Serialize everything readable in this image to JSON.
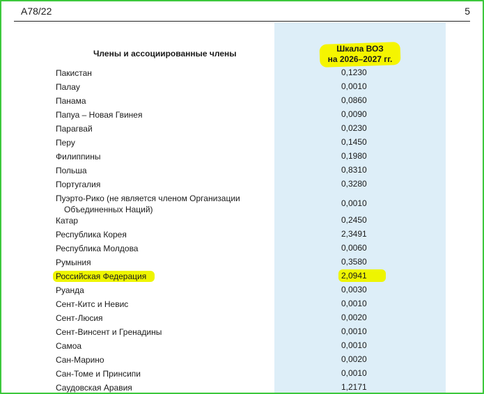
{
  "header": {
    "doc_code": "A78/22",
    "page_number": "5"
  },
  "table": {
    "col_members": "Члены и ассоциированные члены",
    "col_scale_line1": "Шкала ВОЗ",
    "col_scale_line2": "на 2026–2027 гг.",
    "rows": [
      {
        "name": "Пакистан",
        "value": "0,1230"
      },
      {
        "name": "Палау",
        "value": "0,0010"
      },
      {
        "name": "Панама",
        "value": "0,0860"
      },
      {
        "name": "Папуа – Новая Гвинея",
        "value": "0,0090"
      },
      {
        "name": "Парагвай",
        "value": "0,0230"
      },
      {
        "name": "Перу",
        "value": "0,1450"
      },
      {
        "name": "Филиппины",
        "value": "0,1980"
      },
      {
        "name": "Польша",
        "value": "0,8310"
      },
      {
        "name": "Португалия",
        "value": "0,3280"
      },
      {
        "name": "Пуэрто-Рико (не является членом Организации",
        "name_line2": "Объединенных Наций)",
        "value": "0,0010"
      },
      {
        "name": "Катар",
        "value": "0,2450"
      },
      {
        "name": "Республика Корея",
        "value": "2,3491"
      },
      {
        "name": "Республика Молдова",
        "value": "0,0060"
      },
      {
        "name": "Румыния",
        "value": "0,3580"
      },
      {
        "name": "Российская Федерация",
        "value": "2,0941",
        "highlighted": true
      },
      {
        "name": "Руанда",
        "value": "0,0030"
      },
      {
        "name": "Сент-Китс и Невис",
        "value": "0,0010"
      },
      {
        "name": "Сент-Люсия",
        "value": "0,0020"
      },
      {
        "name": "Сент-Винсент и Гренадины",
        "value": "0,0010"
      },
      {
        "name": "Самоа",
        "value": "0,0010"
      },
      {
        "name": "Сан-Марино",
        "value": "0,0020"
      },
      {
        "name": "Сан-Томе и Принсипи",
        "value": "0,0010"
      },
      {
        "name": "Саудовская Аравия",
        "value": "1,2171"
      }
    ]
  },
  "colors": {
    "border": "#3cc83c",
    "column_bg": "#ddeef8",
    "highlight": "#eef500"
  }
}
